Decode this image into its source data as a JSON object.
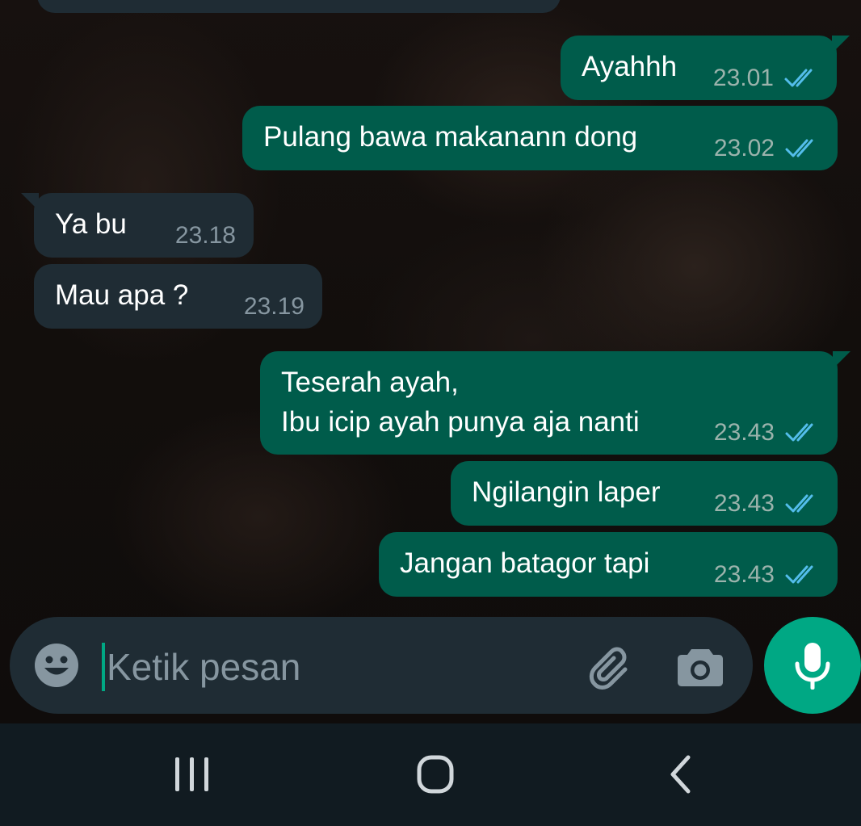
{
  "composer": {
    "placeholder": "Ketik pesan"
  },
  "messages": [
    {
      "direction": "outgoing",
      "text": "Ayahhh",
      "time": "23.01",
      "status": "read"
    },
    {
      "direction": "outgoing",
      "text": "Pulang bawa makanann dong",
      "time": "23.02",
      "status": "read"
    },
    {
      "direction": "incoming",
      "text": "Ya bu",
      "time": "23.18"
    },
    {
      "direction": "incoming",
      "text": "Mau apa ?",
      "time": "23.19"
    },
    {
      "direction": "outgoing",
      "text": "Teserah ayah,\nIbu icip ayah punya aja nanti",
      "time": "23.43",
      "status": "read"
    },
    {
      "direction": "outgoing",
      "text": "Ngilangin laper",
      "time": "23.43",
      "status": "read"
    },
    {
      "direction": "outgoing",
      "text": "Jangan batagor tapi",
      "time": "23.43",
      "status": "read"
    }
  ],
  "icons": {
    "emoji": "smiley-icon",
    "attach": "paperclip-icon",
    "camera": "camera-icon",
    "mic": "microphone-icon",
    "recents": "recent-apps-icon",
    "home": "home-icon",
    "back": "back-icon",
    "read_receipt": "double-check-icon"
  },
  "colors": {
    "outgoing_bubble": "#005c4b",
    "incoming_bubble": "#1f2c34",
    "accent": "#00a884",
    "read_tick": "#53bdeb",
    "nav_bar": "#111b21"
  }
}
